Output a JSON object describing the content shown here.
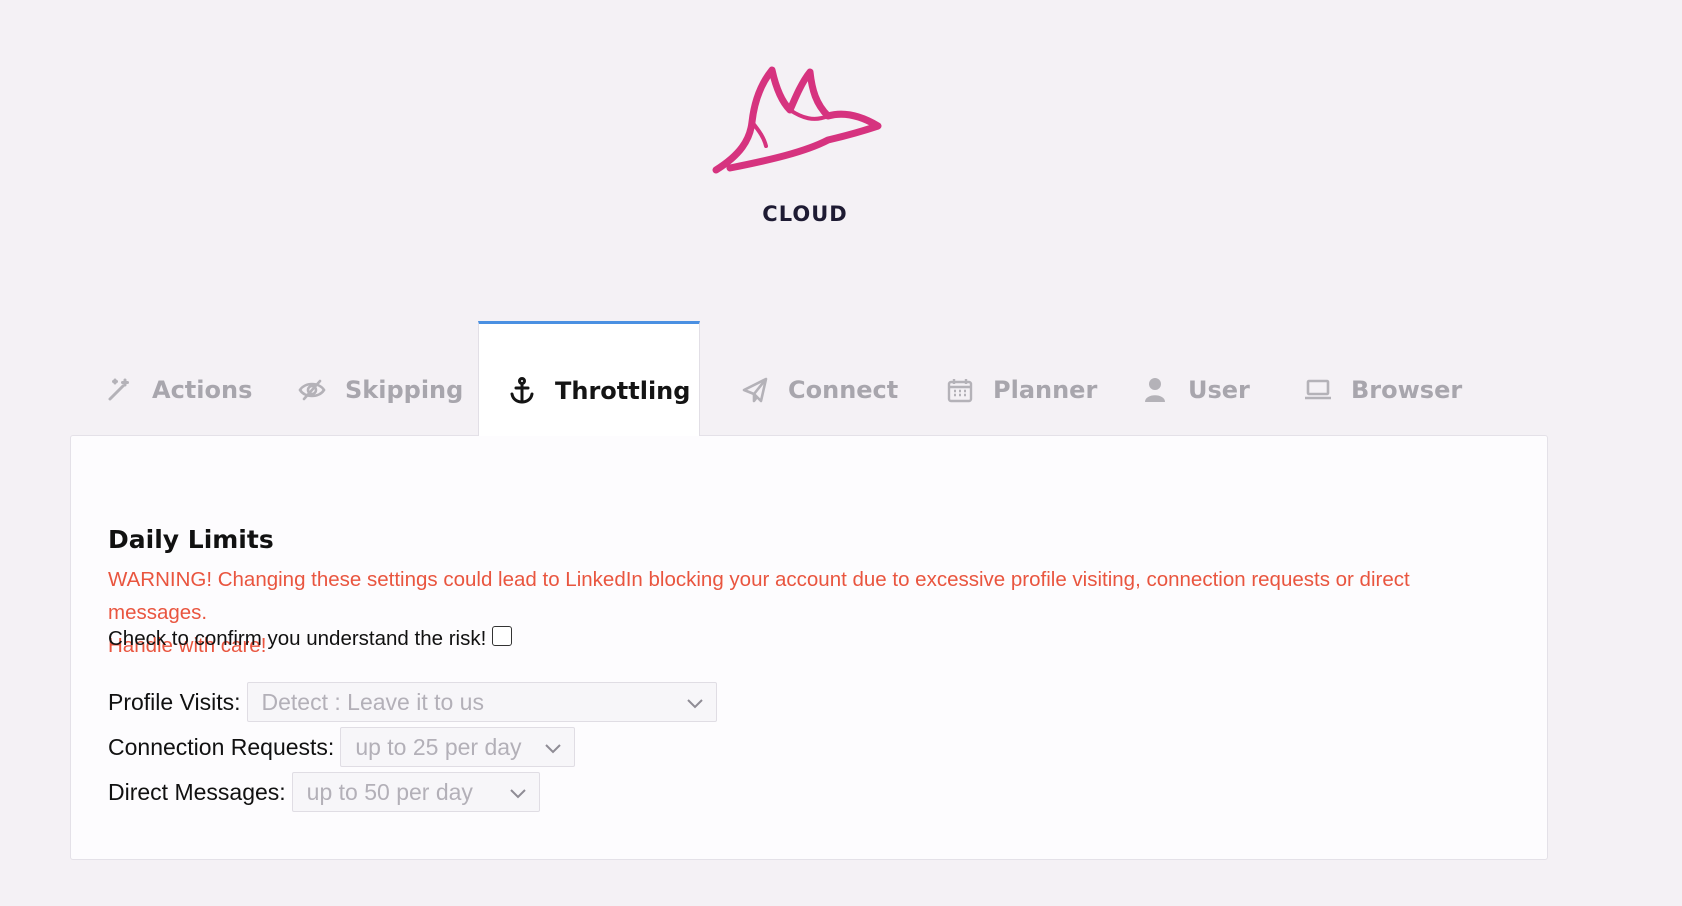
{
  "brand": {
    "name": "CLOUD",
    "logo_color": "#d6337f"
  },
  "tabs": [
    {
      "label": "Actions",
      "icon": "magic-wand-icon",
      "active": false
    },
    {
      "label": "Skipping",
      "icon": "eye-slash-icon",
      "active": false
    },
    {
      "label": "Throttling",
      "icon": "anchor-icon",
      "active": true
    },
    {
      "label": "Connect",
      "icon": "paper-plane-icon",
      "active": false
    },
    {
      "label": "Planner",
      "icon": "calendar-icon",
      "active": false
    },
    {
      "label": "User",
      "icon": "user-icon",
      "active": false
    },
    {
      "label": "Browser",
      "icon": "laptop-icon",
      "active": false
    }
  ],
  "daily_limits": {
    "title": "Daily Limits",
    "warning_line1": "WARNING! Changing these settings could lead to LinkedIn blocking your account due to excessive profile visiting, connection requests or direct messages.",
    "warning_line2": "Handle with care!",
    "confirm_label": "Check to confirm you understand the risk!",
    "confirm_checked": false,
    "fields": {
      "profile_visits": {
        "label": "Profile Visits:",
        "value": "Detect : Leave it to us"
      },
      "connection_requests": {
        "label": "Connection Requests:",
        "value": "up to 25 per day"
      },
      "direct_messages": {
        "label": "Direct Messages:",
        "value": "up to 50 per day"
      }
    }
  },
  "colors": {
    "accent_tab_border": "#4a90e2",
    "warning": "#e9553f",
    "background": "#f4f1f5"
  }
}
